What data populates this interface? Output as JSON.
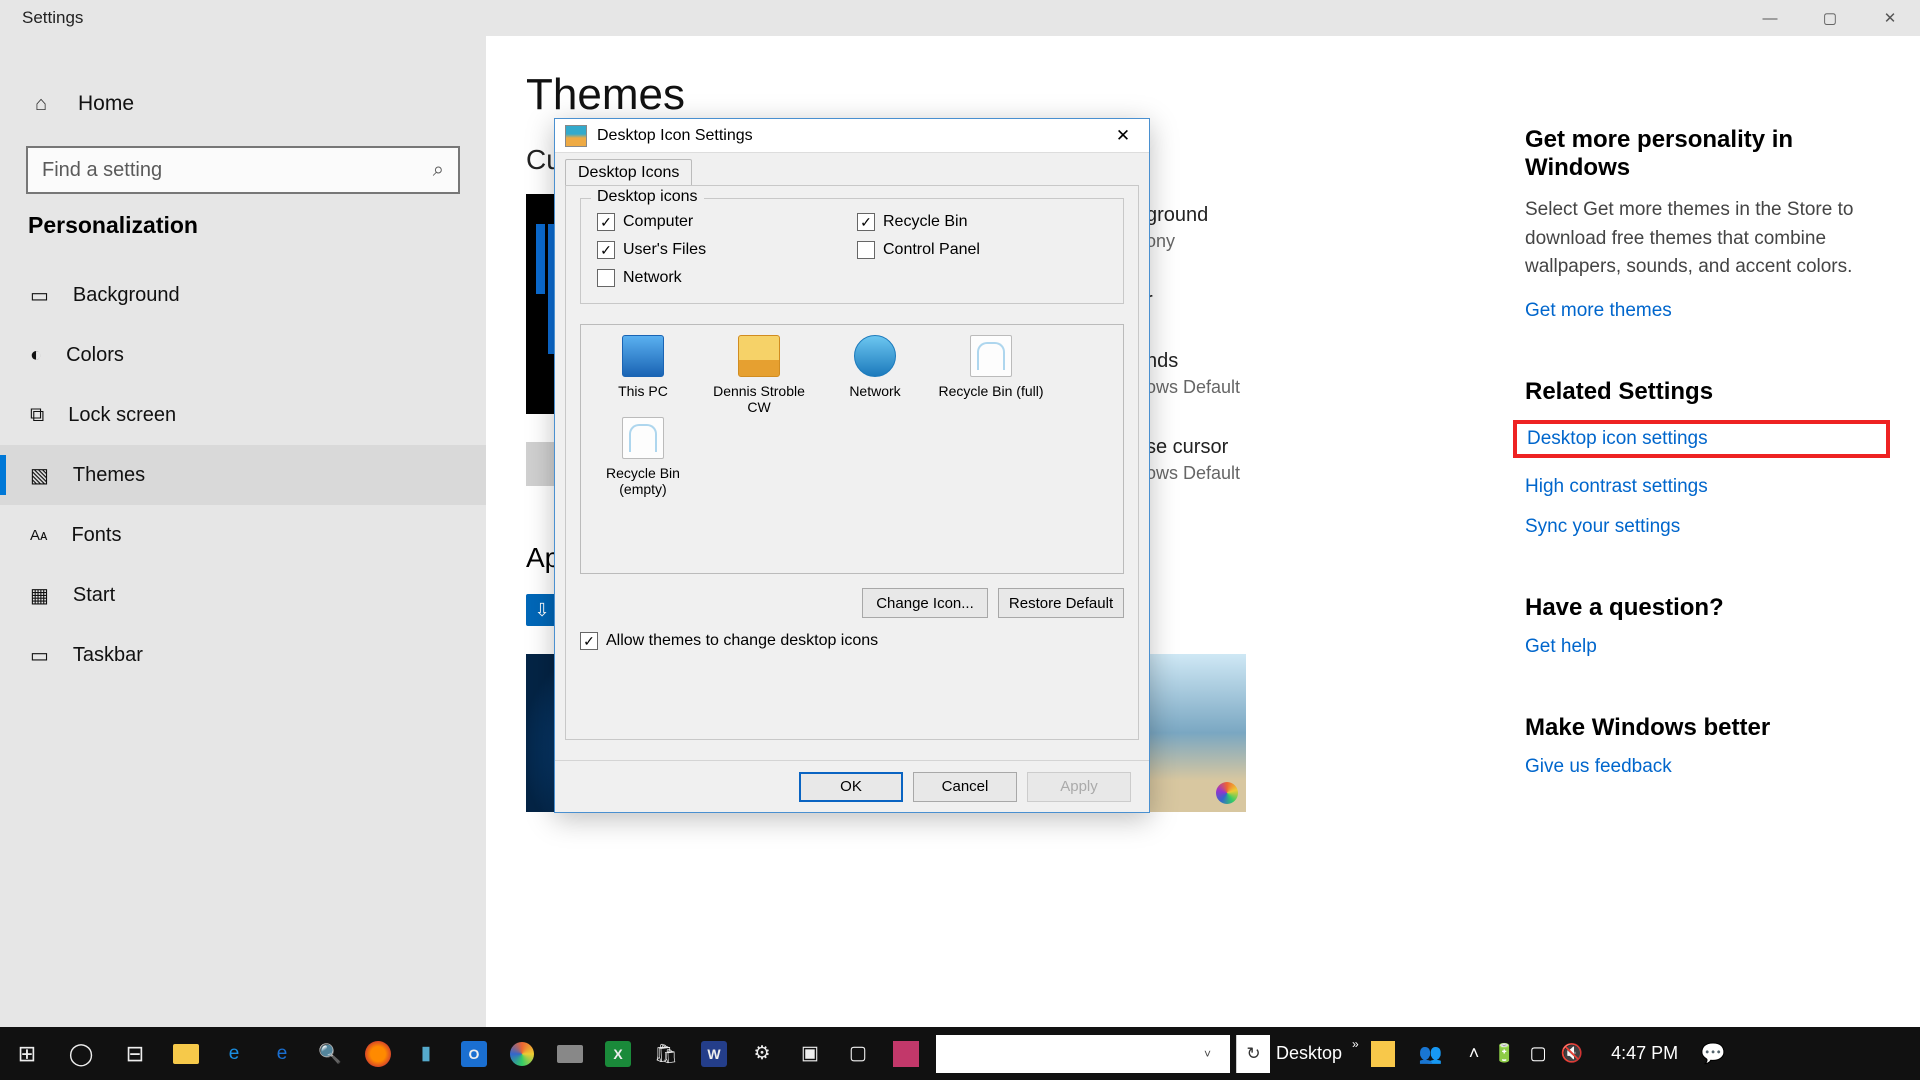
{
  "titlebar": {
    "title": "Settings"
  },
  "sidebar": {
    "home": "Home",
    "search_placeholder": "Find a setting",
    "category": "Personalization",
    "items": [
      {
        "label": "Background",
        "icon": "▭"
      },
      {
        "label": "Colors",
        "icon": "❍"
      },
      {
        "label": "Lock screen",
        "icon": "⧉"
      },
      {
        "label": "Themes",
        "icon": "🖼"
      },
      {
        "label": "Fonts",
        "icon": "Aᴀ"
      },
      {
        "label": "Start",
        "icon": "▦"
      },
      {
        "label": "Taskbar",
        "icon": "▭"
      }
    ]
  },
  "main": {
    "title": "Themes",
    "current_heading": "Cu",
    "apply_heading": "Ap",
    "hidden": {
      "bg_label": "ground",
      "bg_val": "ony",
      "col_label": "r",
      "snd_label": "nds",
      "snd_val": "ows Default",
      "cur_label": "se cursor",
      "cur_val": "ows Default"
    }
  },
  "right": {
    "more_h": "Get more personality in Windows",
    "more_p": "Select Get more themes in the Store to download free themes that combine wallpapers, sounds, and accent colors.",
    "more_link": "Get more themes",
    "related_h": "Related Settings",
    "links": {
      "desktop_icon": "Desktop icon settings",
      "high_contrast": "High contrast settings",
      "sync": "Sync your settings"
    },
    "question_h": "Have a question?",
    "get_help": "Get help",
    "better_h": "Make Windows better",
    "feedback": "Give us feedback"
  },
  "dialog": {
    "title": "Desktop Icon Settings",
    "tab": "Desktop Icons",
    "group_title": "Desktop icons",
    "checks": {
      "computer": {
        "label": "Computer",
        "checked": true
      },
      "recycle": {
        "label": "Recycle Bin",
        "checked": true
      },
      "users": {
        "label": "User's Files",
        "checked": true
      },
      "cpanel": {
        "label": "Control Panel",
        "checked": false
      },
      "network": {
        "label": "Network",
        "checked": false
      }
    },
    "icons": [
      {
        "label": "This PC"
      },
      {
        "label": "Dennis Stroble CW"
      },
      {
        "label": "Network"
      },
      {
        "label": "Recycle Bin (full)"
      },
      {
        "label": "Recycle Bin (empty)"
      }
    ],
    "change_icon": "Change Icon...",
    "restore": "Restore Default",
    "allow": "Allow themes to change desktop icons",
    "ok": "OK",
    "cancel": "Cancel",
    "apply": "Apply"
  },
  "taskbar": {
    "desktop_label": "Desktop",
    "time": "4:47 PM"
  }
}
